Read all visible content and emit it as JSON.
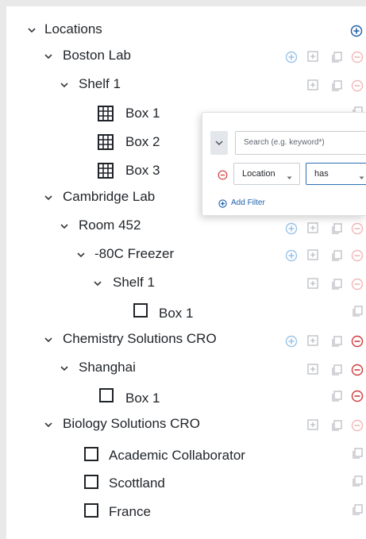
{
  "colors": {
    "blue_accent": "#1f5fa8",
    "icon_gray": "#b9bdc2",
    "icon_blue_light": "#9bc4e8",
    "remove_red": "#d23b3b",
    "remove_red_light": "#f2b8b8"
  },
  "tree": [
    {
      "label": "Locations",
      "chevron": true
    },
    {
      "label": "Boston Lab",
      "chevron": true
    },
    {
      "label": "Shelf 1",
      "chevron": true
    },
    {
      "label": "Box 1",
      "icon": "grid-box-icon"
    },
    {
      "label": "Box 2",
      "icon": "grid-box-icon"
    },
    {
      "label": "Box 3",
      "icon": "grid-box-icon"
    },
    {
      "label": "Cambridge Lab",
      "chevron": true
    },
    {
      "label": "Room 452",
      "chevron": true
    },
    {
      "label": "-80C Freezer",
      "chevron": true
    },
    {
      "label": "Shelf 1",
      "chevron": true
    },
    {
      "label": "Box 1",
      "icon": "square-box-icon"
    },
    {
      "label": "Chemistry Solutions CRO",
      "chevron": true
    },
    {
      "label": "Shanghai",
      "chevron": true
    },
    {
      "label": "Box 1",
      "icon": "square-box-icon"
    },
    {
      "label": "Biology Solutions CRO",
      "chevron": true
    },
    {
      "label": "Academic Collaborator",
      "icon": "square-box-icon"
    },
    {
      "label": "Scottland",
      "icon": "square-box-icon"
    },
    {
      "label": "France",
      "icon": "square-box-icon"
    }
  ],
  "filter": {
    "search_placeholder": "Search (e.g. keyword*)",
    "field_value": "Location",
    "operator_value": "has",
    "add_filter_label": "Add Filter"
  }
}
